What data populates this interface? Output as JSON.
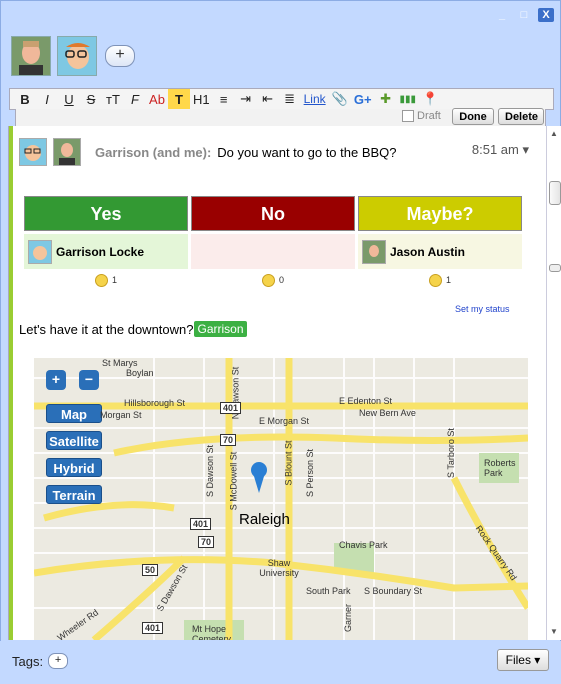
{
  "window": {
    "controls": [
      "_",
      "□",
      "X"
    ]
  },
  "participants": {
    "add_label": "+"
  },
  "toolbar": {
    "items": [
      "B",
      "I",
      "U",
      "S",
      "тT",
      "F",
      "Ab",
      "T",
      "H1",
      "≡",
      "⇥",
      "⇤",
      "≣",
      "Link",
      "📎",
      "G+",
      "✚",
      "▮▮▮",
      "📍"
    ]
  },
  "actions": {
    "draft_label": "Draft",
    "done_label": "Done",
    "delete_label": "Delete"
  },
  "wave": {
    "participants_label": "Garrison (and me):",
    "message": "Do you want to go to the BBQ?",
    "time": "8:51 am",
    "colors": {
      "accent_green": "#9acd32"
    }
  },
  "poll": {
    "columns": [
      {
        "label": "Yes",
        "color": "#339933",
        "voter": "Garrison Locke",
        "count": "1",
        "cell_bg": "#e4f6d8"
      },
      {
        "label": "No",
        "color": "#990000",
        "voter": "",
        "count": "0",
        "cell_bg": "#fbeceb"
      },
      {
        "label": "Maybe?",
        "color": "#cccc00",
        "voter": "Jason Austin",
        "count": "1",
        "cell_bg": "#f7f7e2"
      }
    ],
    "set_status_label": "Set my status"
  },
  "reply": {
    "text": "Let's have it at the downtown?",
    "mention": "Garrison"
  },
  "map": {
    "zoom_in": "+",
    "zoom_out": "−",
    "buttons": [
      "Map",
      "Satellite",
      "Hybrid",
      "Terrain"
    ],
    "city_label": "Raleigh",
    "labels": [
      "St Marys",
      "Boylan",
      "Hillsborough St",
      "Morgan St",
      "N Dawson St",
      "E Edenton St",
      "New Bern Ave",
      "E Morgan St",
      "S Dawson St",
      "S McDowell St",
      "S Blount St",
      "S Person St",
      "S Tarboro St",
      "Roberts Park",
      "Chavis Park",
      "Shaw University",
      "South Park",
      "S Boundary St",
      "Rock Quarry Rd",
      "S Dawson St",
      "Wheeler Rd",
      "Mt Hope Cemetery",
      "Garner"
    ],
    "shields": [
      "401",
      "70",
      "401",
      "70",
      "50",
      "401"
    ]
  },
  "footer": {
    "tags_label": "Tags:",
    "tags_add": "+",
    "files_label": "Files ▾"
  }
}
